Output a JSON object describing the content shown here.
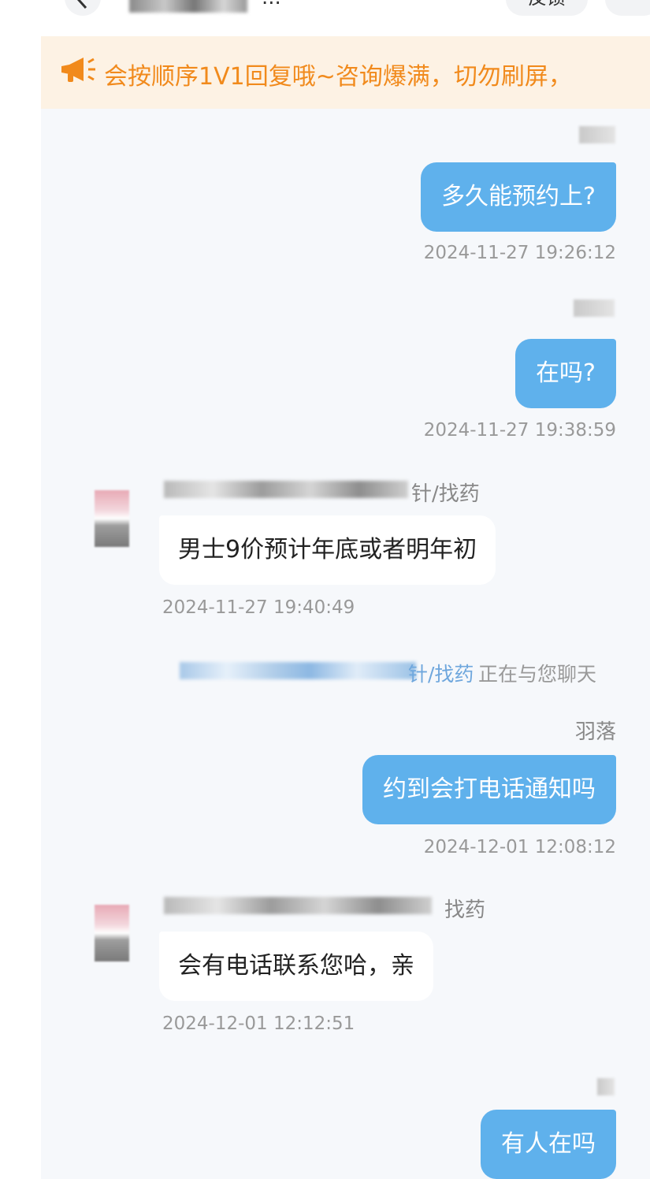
{
  "header": {
    "title_suffix": "...",
    "feedback_label": "反馈",
    "more_label": "···"
  },
  "notice": {
    "text": "会按顺序1V1回复哦~咨询爆满，切勿刷屏，"
  },
  "agent": {
    "label_1": "针/找药",
    "label_2": "找药"
  },
  "messages": [
    {
      "from": "me",
      "text": "多久能预约上?",
      "time": "2024-11-27 19:26:12"
    },
    {
      "from": "me",
      "text": "在吗?",
      "time": "2024-11-27 19:38:59"
    },
    {
      "from": "agent",
      "text": "男士9价预计年底或者明年初",
      "time": "2024-11-27 19:40:49"
    },
    {
      "from": "me",
      "text": "约到会打电话通知吗",
      "time": "2024-12-01 12:08:12"
    },
    {
      "from": "agent",
      "text": "会有电话联系您哈，亲",
      "time": "2024-12-01 12:12:51"
    },
    {
      "from": "me",
      "text": "有人在吗",
      "time": ""
    }
  ],
  "system": {
    "link_text": "针/找药",
    "status_text": "正在与您聊天"
  },
  "me": {
    "name": "羽落"
  },
  "colors": {
    "bubble_me": "#5fb1ec",
    "notice_bg": "#fdf2e4",
    "notice_text": "#f18a1c"
  }
}
